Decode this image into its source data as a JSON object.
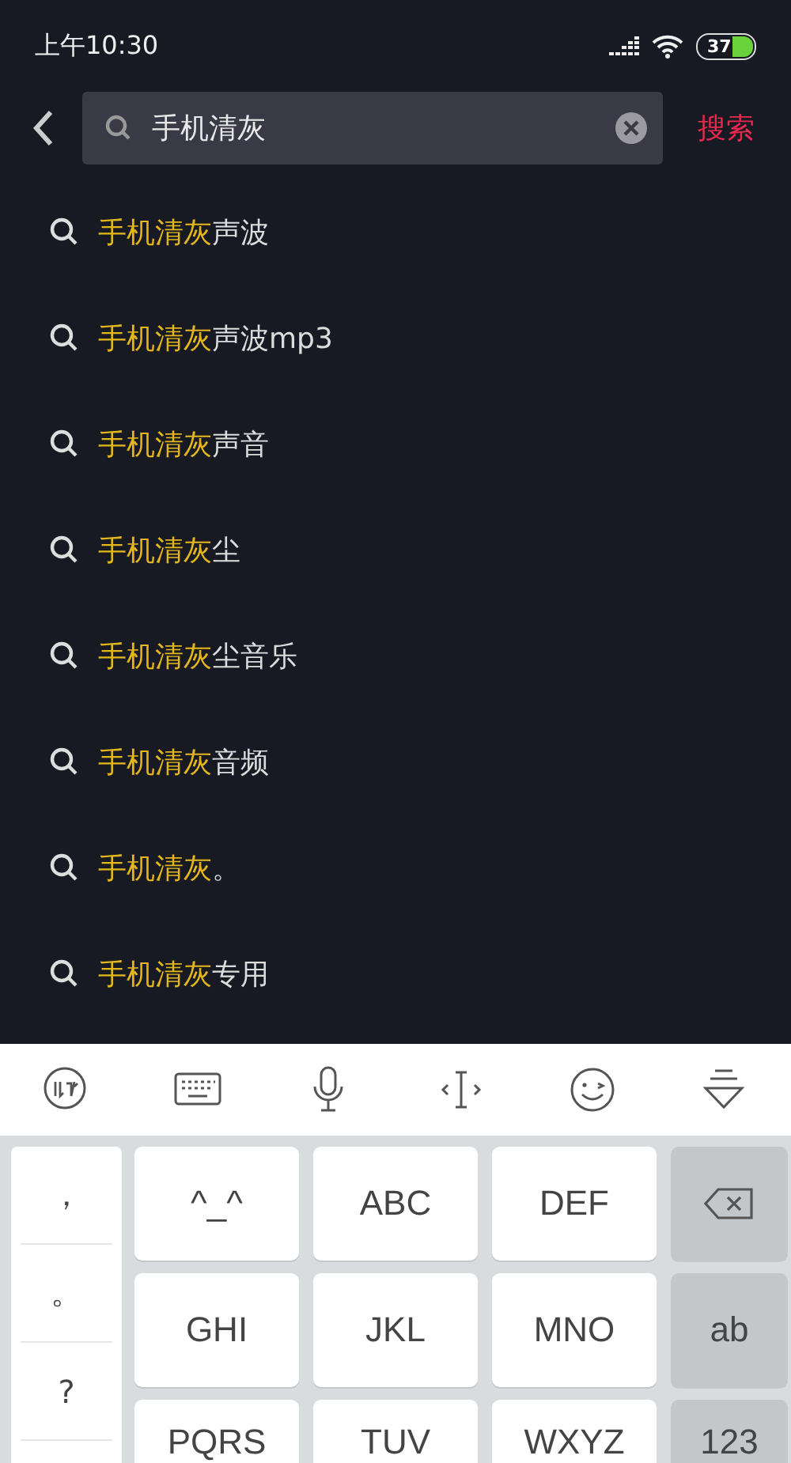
{
  "status_bar": {
    "time": "上午10:30",
    "battery": "37"
  },
  "search": {
    "value": "手机清灰",
    "submit": "搜索"
  },
  "suggestions": [
    {
      "match": "手机清灰",
      "rest": "声波"
    },
    {
      "match": "手机清灰",
      "rest": "声波mp3"
    },
    {
      "match": "手机清灰",
      "rest": "声音"
    },
    {
      "match": "手机清灰",
      "rest": "尘"
    },
    {
      "match": "手机清灰",
      "rest": "尘音乐"
    },
    {
      "match": "手机清灰",
      "rest": "音频"
    },
    {
      "match": "手机清灰",
      "rest": "。"
    },
    {
      "match": "手机清灰",
      "rest": "专用"
    }
  ],
  "keyboard": {
    "toolbar": [
      {
        "kind": "logo"
      },
      {
        "kind": "keyboard"
      },
      {
        "kind": "mic"
      },
      {
        "kind": "cursor"
      },
      {
        "kind": "emoji"
      },
      {
        "kind": "hide"
      }
    ],
    "symbols": [
      "，",
      "。",
      "?"
    ],
    "keys": [
      {
        "kind": "char",
        "label": "^_^"
      },
      {
        "kind": "char",
        "label": "ABC"
      },
      {
        "kind": "char",
        "label": "DEF"
      },
      {
        "kind": "delete"
      },
      {
        "kind": "char",
        "label": "GHI"
      },
      {
        "kind": "char",
        "label": "JKL"
      },
      {
        "kind": "char",
        "label": "MNO"
      },
      {
        "kind": "func",
        "label": "ab"
      },
      {
        "kind": "char",
        "label": "PQRS"
      },
      {
        "kind": "char",
        "label": "TUV"
      },
      {
        "kind": "char",
        "label": "WXYZ"
      },
      {
        "kind": "func",
        "label": "123"
      }
    ]
  }
}
